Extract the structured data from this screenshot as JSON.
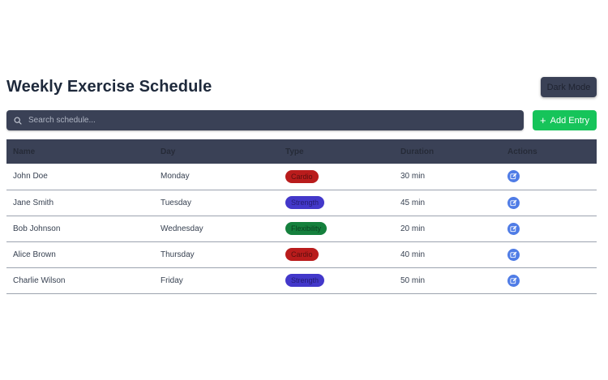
{
  "header": {
    "title": "Weekly Exercise Schedule",
    "dark_mode_label": "Dark Mode"
  },
  "toolbar": {
    "search_placeholder": "Search schedule...",
    "search_icon": "search-icon",
    "add_label": "Add Entry",
    "add_icon": "plus-icon"
  },
  "table": {
    "columns": [
      "Name",
      "Day",
      "Type",
      "Duration",
      "Actions"
    ],
    "rows": [
      {
        "name": "John Doe",
        "day": "Monday",
        "type": "Cardio",
        "type_key": "cardio",
        "duration": "30 min"
      },
      {
        "name": "Jane Smith",
        "day": "Tuesday",
        "type": "Strength",
        "type_key": "strength",
        "duration": "45 min"
      },
      {
        "name": "Bob Johnson",
        "day": "Wednesday",
        "type": "Flexibility",
        "type_key": "flexibility",
        "duration": "20 min"
      },
      {
        "name": "Alice Brown",
        "day": "Thursday",
        "type": "Cardio",
        "type_key": "cardio",
        "duration": "40 min"
      },
      {
        "name": "Charlie Wilson",
        "day": "Friday",
        "type": "Strength",
        "type_key": "strength",
        "duration": "50 min"
      }
    ],
    "action_icon": "edit-icon"
  },
  "colors": {
    "header_bg": "#3a4156",
    "add_button": "#16c45a",
    "cardio": "#b91c1c",
    "strength": "#4338ca",
    "flexibility": "#15803d",
    "edit_button": "#4f7ce6"
  }
}
